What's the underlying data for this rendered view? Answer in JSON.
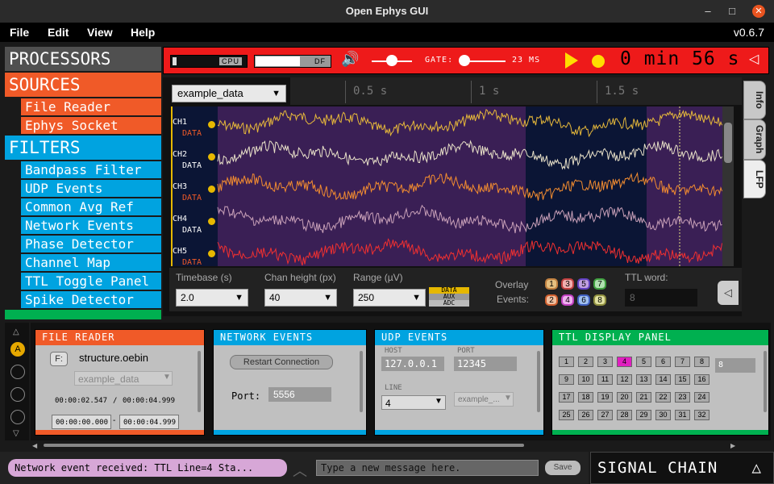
{
  "window": {
    "title": "Open Ephys GUI"
  },
  "menu": {
    "items": [
      "File",
      "Edit",
      "View",
      "Help"
    ],
    "version": "v0.6.7"
  },
  "processors": {
    "title": "PROCESSORS",
    "sources_label": "SOURCES",
    "sources": [
      "File Reader",
      "Ephys Socket"
    ],
    "filters_label": "FILTERS",
    "filters": [
      "Bandpass Filter",
      "UDP Events",
      "Common Avg Ref",
      "Network Events",
      "Phase Detector",
      "Channel Map",
      "TTL Toggle Panel",
      "Spike Detector"
    ],
    "colors": {
      "title": "#505050",
      "sources": "#f05a28",
      "filters": "#00a3e0",
      "sinks": "#00b050"
    }
  },
  "toolbar": {
    "cpu_label": "CPU",
    "cpu_level": 0.05,
    "df_label": "DF",
    "df_level": 0.6,
    "gate_label": "GATE:",
    "gate_value": "23 MS",
    "clock": "0 min 56 s",
    "color": "#ee1a1a"
  },
  "lfp_viewer": {
    "source": "example_data",
    "time_ticks": [
      "0.5 s",
      "1 s",
      "1.5 s"
    ],
    "channels": [
      {
        "name": "CH1",
        "type": "DATA",
        "color": "#e6b83a"
      },
      {
        "name": "CH2",
        "type": "DATA",
        "color": "#e8e0c8"
      },
      {
        "name": "CH3",
        "type": "DATA",
        "color": "#f28c30"
      },
      {
        "name": "CH4",
        "type": "DATA",
        "color": "#c8a0b8"
      },
      {
        "name": "CH5",
        "type": "DATA",
        "color": "#f03030"
      }
    ],
    "options": {
      "timebase_label": "Timebase (s)",
      "timebase": "2.0",
      "chan_height_label": "Chan height (px)",
      "chan_height": "40",
      "range_label": "Range (µV)",
      "range": "250",
      "type_buttons": [
        "DATA",
        "AUX",
        "ADC"
      ],
      "overlay_label_1": "Overlay",
      "overlay_label_2": "Events:",
      "overlay_buttons": [
        "1",
        "3",
        "5",
        "7",
        "2",
        "4",
        "6",
        "8"
      ],
      "ttl_word_label": "TTL word:",
      "ttl_word": "8"
    },
    "tabs": [
      "Info",
      "Graph",
      "LFP"
    ]
  },
  "editors": {
    "file_reader": {
      "title": "FILE READER",
      "file_btn": "F:",
      "filename": "structure.oebin",
      "stream": "example_data",
      "time_current": "00:00:02.547",
      "time_sep": "/",
      "time_total": "00:00:04.999",
      "range_start": "00:00:00.000",
      "range_dash": "-",
      "range_end": "00:00:04.999"
    },
    "network_events": {
      "title": "NETWORK EVENTS",
      "restart_label": "Restart Connection",
      "port_label": "Port:",
      "port": "5556"
    },
    "udp_events": {
      "title": "UDP EVENTS",
      "host_label": "HOST",
      "host": "127.0.0.1",
      "port_label": "PORT",
      "port": "12345",
      "line_label": "LINE",
      "line": "4",
      "stream": "example_..."
    },
    "ttl_display": {
      "title": "TTL DISPLAY PANEL",
      "cells": [
        "1",
        "2",
        "3",
        "4",
        "5",
        "6",
        "7",
        "8",
        "9",
        "10",
        "11",
        "12",
        "13",
        "14",
        "15",
        "16",
        "17",
        "18",
        "19",
        "20",
        "21",
        "22",
        "23",
        "24",
        "25",
        "26",
        "27",
        "28",
        "29",
        "30",
        "31",
        "32"
      ],
      "active": "4",
      "word": "8"
    }
  },
  "graph_nav": {
    "active": "A"
  },
  "message_center": {
    "last_message": "Network event received: TTL Line=4 Sta...",
    "placeholder": "Type a new message here.",
    "save_label": "Save"
  },
  "signal_chain": {
    "label": "SIGNAL CHAIN",
    "toggle": "△"
  }
}
